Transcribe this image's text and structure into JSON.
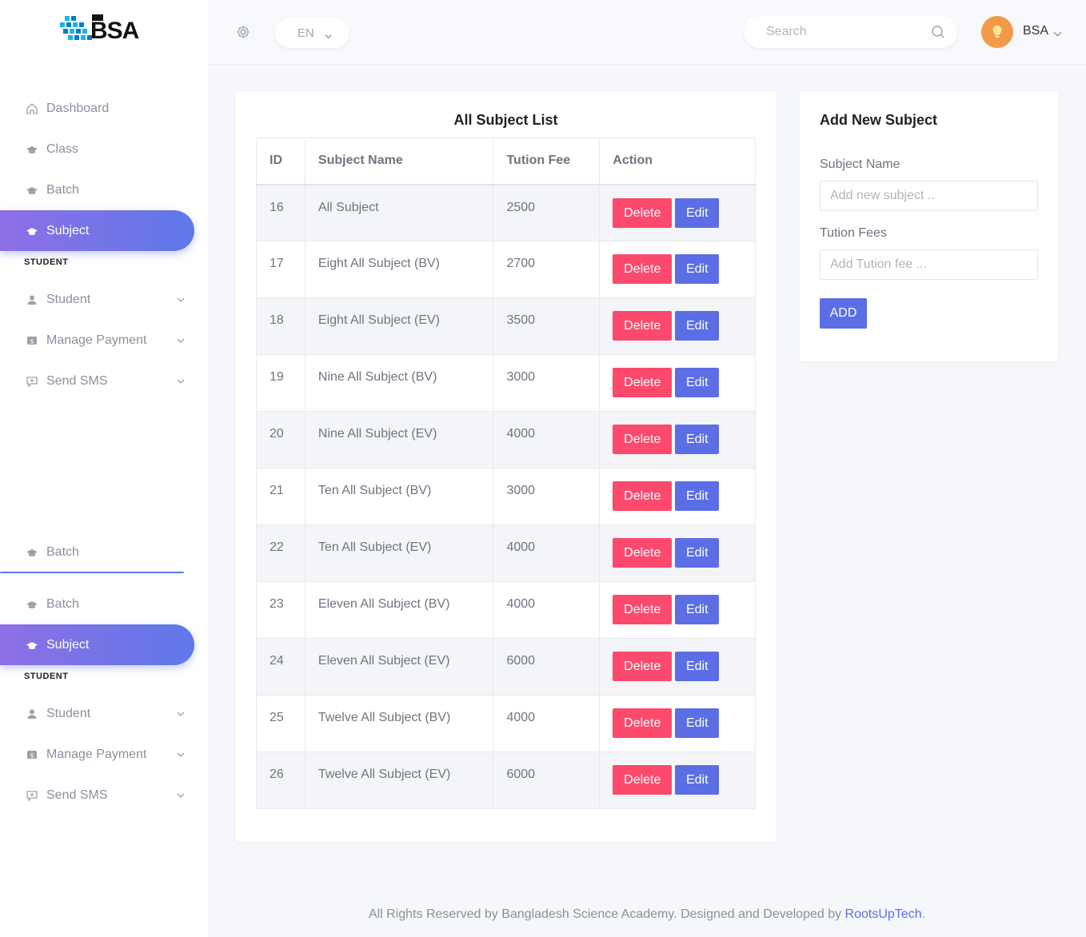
{
  "logo": {
    "text": "BSA"
  },
  "sidebar": {
    "items_top": [
      {
        "label": "Dashboard",
        "icon": "home-icon"
      },
      {
        "label": "Class",
        "icon": "graduation-cap-icon"
      },
      {
        "label": "Batch",
        "icon": "graduation-cap-icon"
      },
      {
        "label": "Subject",
        "icon": "graduation-cap-icon",
        "active": true
      }
    ],
    "section_label_1": "STUDENT",
    "items_student_1": [
      {
        "label": "Student",
        "icon": "user-icon"
      },
      {
        "label": "Manage Payment",
        "icon": "payment-icon"
      },
      {
        "label": "Send SMS",
        "icon": "sms-icon"
      }
    ],
    "duplicate_batch_1": "Batch",
    "duplicate_batch_2": "Batch",
    "duplicate_subject": "Subject",
    "section_label_2": "STUDENT",
    "items_student_2": [
      {
        "label": "Student",
        "icon": "user-icon"
      },
      {
        "label": "Manage Payment",
        "icon": "payment-icon"
      },
      {
        "label": "Send SMS",
        "icon": "sms-icon"
      }
    ]
  },
  "header": {
    "language": "EN",
    "search_placeholder": "Search",
    "user_name": "BSA"
  },
  "subject_list": {
    "title": "All Subject List",
    "columns": [
      "ID",
      "Subject Name",
      "Tution Fee",
      "Action"
    ],
    "delete_label": "Delete",
    "edit_label": "Edit",
    "rows": [
      {
        "id": "16",
        "name": "All Subject",
        "fee": "2500"
      },
      {
        "id": "17",
        "name": "Eight All Subject (BV)",
        "fee": "2700"
      },
      {
        "id": "18",
        "name": "Eight All Subject (EV)",
        "fee": "3500"
      },
      {
        "id": "19",
        "name": "Nine All Subject (BV)",
        "fee": "3000"
      },
      {
        "id": "20",
        "name": "Nine All Subject (EV)",
        "fee": "4000"
      },
      {
        "id": "21",
        "name": "Ten All Subject (BV)",
        "fee": "3000"
      },
      {
        "id": "22",
        "name": "Ten All Subject (EV)",
        "fee": "4000"
      },
      {
        "id": "23",
        "name": "Eleven All Subject (BV)",
        "fee": "4000"
      },
      {
        "id": "24",
        "name": "Eleven All Subject (EV)",
        "fee": "6000"
      },
      {
        "id": "25",
        "name": "Twelve All Subject (BV)",
        "fee": "4000"
      },
      {
        "id": "26",
        "name": "Twelve All Subject (EV)",
        "fee": "6000"
      }
    ]
  },
  "add_subject": {
    "title": "Add New Subject",
    "subject_label": "Subject Name",
    "subject_placeholder": "Add new subject ..",
    "fee_label": "Tution Fees",
    "fee_placeholder": "Add Tution fee ...",
    "add_button": "ADD"
  },
  "footer": {
    "text": "All Rights Reserved by Bangladesh Science Academy. Designed and Developed by ",
    "link": "RootsUpTech",
    "end": "."
  },
  "colors": {
    "accent": "#5b6ee6",
    "danger": "#fb4a6d",
    "active_gradient_start": "#8e6fe6",
    "avatar": "#f39a48"
  }
}
